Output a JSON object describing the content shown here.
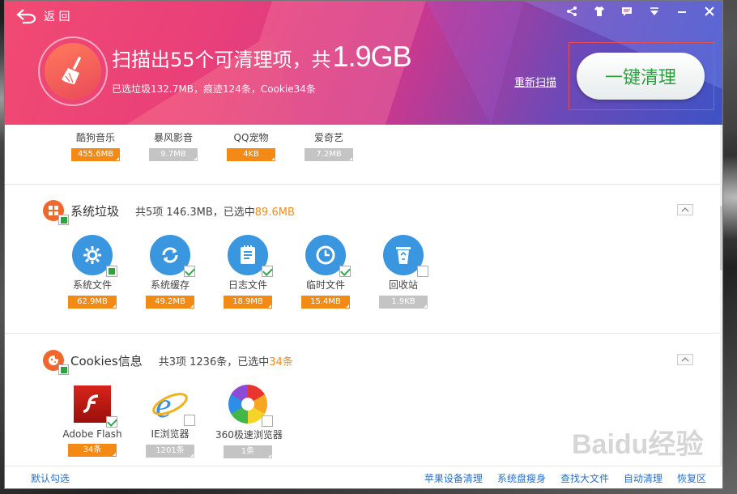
{
  "header": {
    "back_label": "返 回",
    "headline_prefix": "扫描出55个可清理项，共",
    "headline_size": "1.9GB",
    "subline": "已选垃圾132.7MB，痕迹124条，Cookie34条",
    "rescan_label": "重新扫描",
    "clean_button_label": "一键清理"
  },
  "software_row": [
    {
      "label": "酷狗音乐",
      "size": "455.6MB",
      "selected": true
    },
    {
      "label": "暴风影音",
      "size": "9.7MB",
      "selected": false
    },
    {
      "label": "QQ宠物",
      "size": "4KB",
      "selected": true
    },
    {
      "label": "爱奇艺",
      "size": "7.2MB",
      "selected": false
    }
  ],
  "system_junk": {
    "title": "系统垃圾",
    "summary_prefix": "共5项 146.3MB，已选中",
    "summary_selected": "89.6MB",
    "items": [
      {
        "label": "系统文件",
        "size": "62.9MB",
        "icon": "gear-icon",
        "checked": "partial"
      },
      {
        "label": "系统缓存",
        "size": "49.2MB",
        "icon": "refresh-icon",
        "checked": "checked"
      },
      {
        "label": "日志文件",
        "size": "18.9MB",
        "icon": "log-document-icon",
        "checked": "checked"
      },
      {
        "label": "临时文件",
        "size": "15.4MB",
        "icon": "clock-icon",
        "checked": "checked"
      },
      {
        "label": "回收站",
        "size": "1.9KB",
        "icon": "recycle-bin-icon",
        "checked": "unchecked"
      }
    ]
  },
  "cookies": {
    "title": "Cookies信息",
    "summary_prefix": "共3项 1236条，已选中",
    "summary_selected": "34条",
    "items": [
      {
        "label": "Adobe Flash",
        "size": "34条",
        "icon": "adobe-flash-icon",
        "checked": "checked"
      },
      {
        "label": "IE浏览器",
        "size": "1201条",
        "icon": "ie-browser-icon",
        "checked": "unchecked"
      },
      {
        "label": "360极速浏览器",
        "size": "1条",
        "icon": "360-browser-icon",
        "checked": "unchecked"
      }
    ]
  },
  "footer": {
    "default_select_label": "默认勾选",
    "links": [
      "苹果设备清理",
      "系统盘瘦身",
      "查找大文件",
      "自动清理",
      "恢复区"
    ]
  },
  "watermark": "Baidu经验",
  "colors": {
    "accent_orange": "#f38a15",
    "accent_green": "#2aa13e",
    "link_blue": "#2a6fc9"
  }
}
